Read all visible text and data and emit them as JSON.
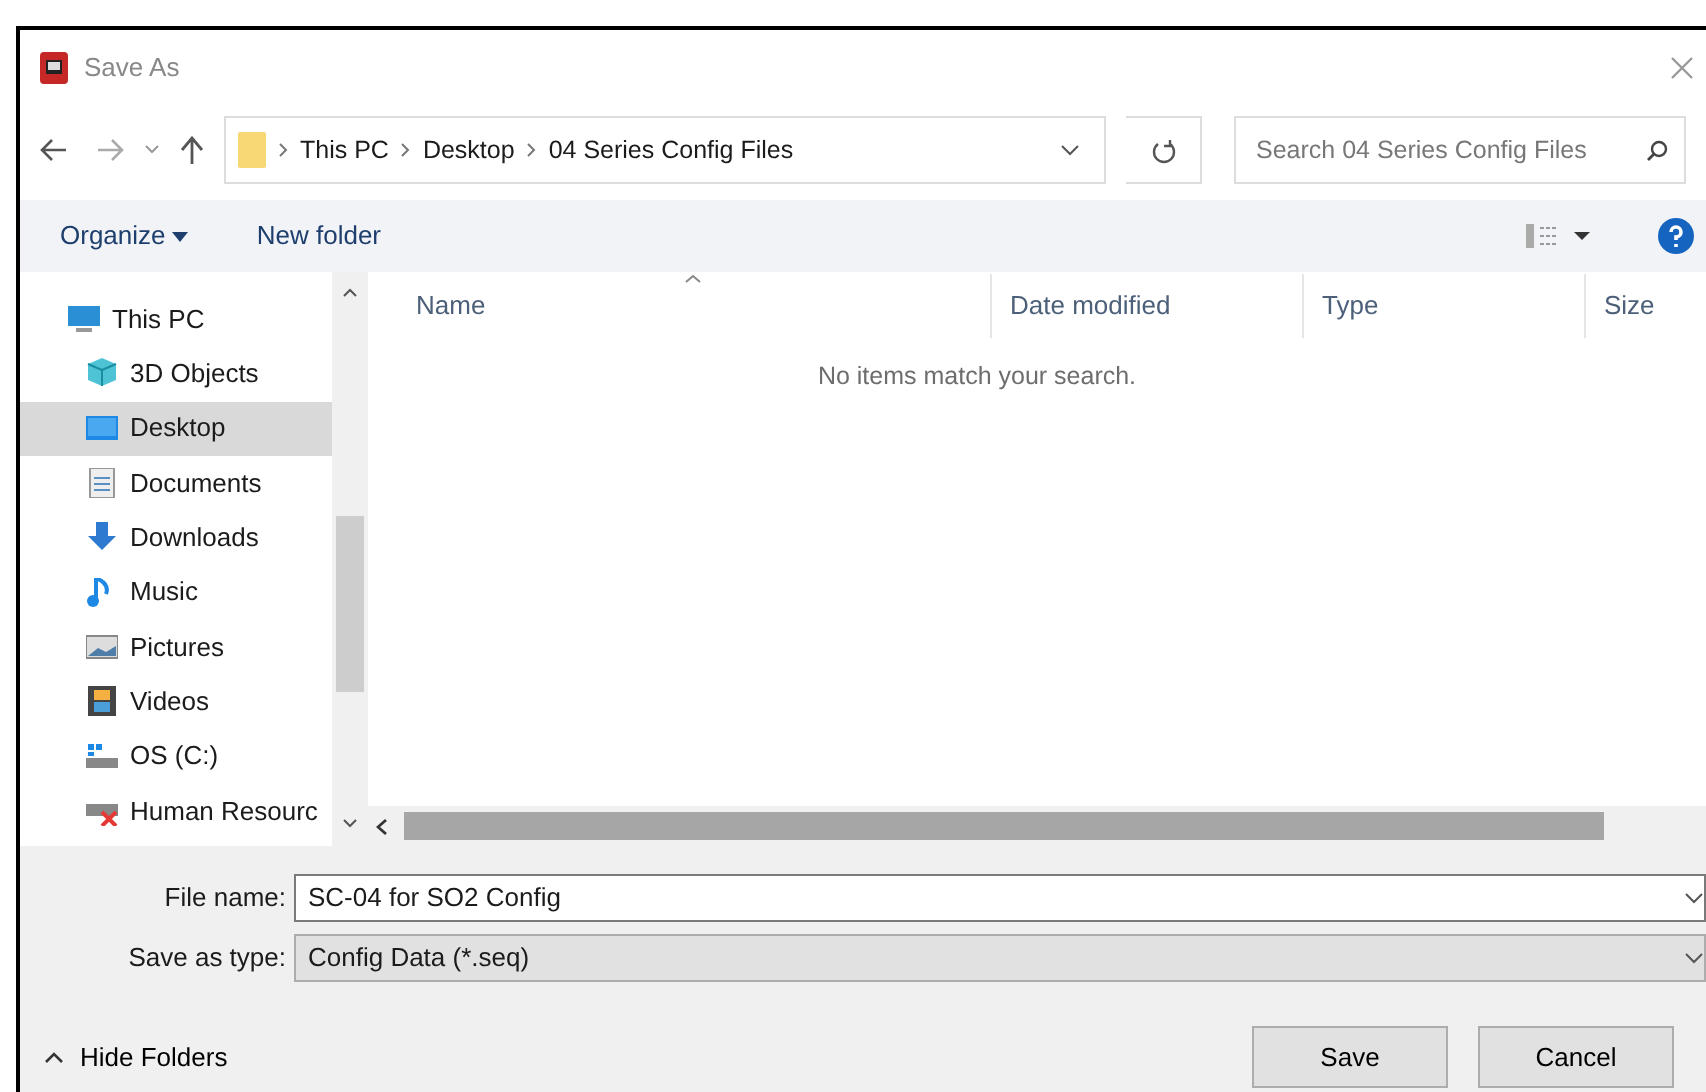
{
  "window": {
    "title": "Save As"
  },
  "address_bar": {
    "segments": [
      "This PC",
      "Desktop",
      "04 Series Config Files"
    ]
  },
  "search": {
    "placeholder": "Search 04 Series Config Files"
  },
  "toolbar": {
    "organize": "Organize",
    "new_folder": "New folder"
  },
  "sidebar": {
    "items": [
      {
        "label": "This PC",
        "selected": false,
        "children": [
          {
            "label": "3D Objects",
            "selected": false
          },
          {
            "label": "Desktop",
            "selected": true
          },
          {
            "label": "Documents",
            "selected": false
          },
          {
            "label": "Downloads",
            "selected": false
          },
          {
            "label": "Music",
            "selected": false
          },
          {
            "label": "Pictures",
            "selected": false
          },
          {
            "label": "Videos",
            "selected": false
          },
          {
            "label": "OS (C:)",
            "selected": false
          },
          {
            "label": "Human Resourc",
            "selected": false
          }
        ]
      }
    ]
  },
  "file_list": {
    "columns": [
      "Name",
      "Date modified",
      "Type",
      "Size"
    ],
    "empty_message": "No items match your search."
  },
  "file_name": {
    "label": "File name:",
    "value": "SC-04 for SO2 Config"
  },
  "save_as_type": {
    "label": "Save as type:",
    "value": "Config Data (*.seq)"
  },
  "hide_folders": "Hide Folders",
  "buttons": [
    "Save",
    "Cancel"
  ]
}
